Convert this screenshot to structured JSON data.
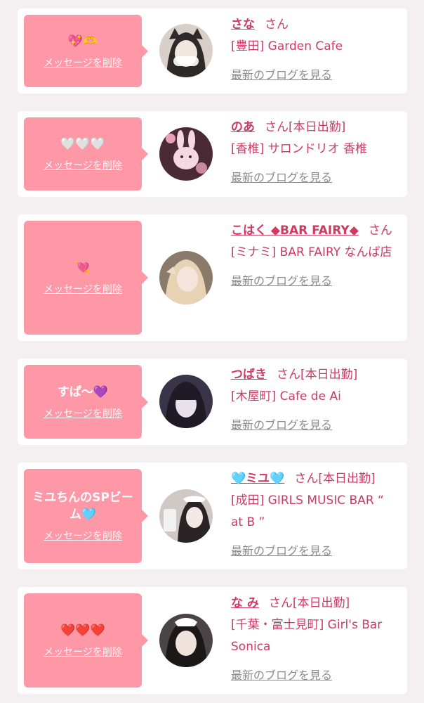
{
  "common": {
    "delete_label": "メッセージを削除",
    "san": "さん",
    "blog_label": "最新のブログを見る"
  },
  "cards": [
    {
      "message": "💖🫶",
      "name": "さな",
      "status": "",
      "shop": "[豊田] Garden Cafe"
    },
    {
      "message": "🤍🤍🤍",
      "name": "のあ",
      "status": "[本日出勤]",
      "shop": "[香椎] サロンドリオ 香椎"
    },
    {
      "message": "💘",
      "name": "こはく ◆BAR FAIRY◆",
      "status": "",
      "shop": "[ミナミ] BAR FAIRY なんば店"
    },
    {
      "message": "すぱ〜💜",
      "name": "つばき",
      "status": "[本日出勤]",
      "shop": "[木屋町] Cafe de Ai"
    },
    {
      "message": "ミユちんのSPビーム🩵",
      "name": "🩵ミユ🩵",
      "status": "[本日出勤]",
      "shop": "[成田] GIRLS MUSIC BAR “ at B ”"
    },
    {
      "message": "❤️❤️❤️",
      "name": "な み",
      "status": "[本日出勤]",
      "shop": "[千葉・富士見町] Girl's Bar Sonica"
    }
  ]
}
